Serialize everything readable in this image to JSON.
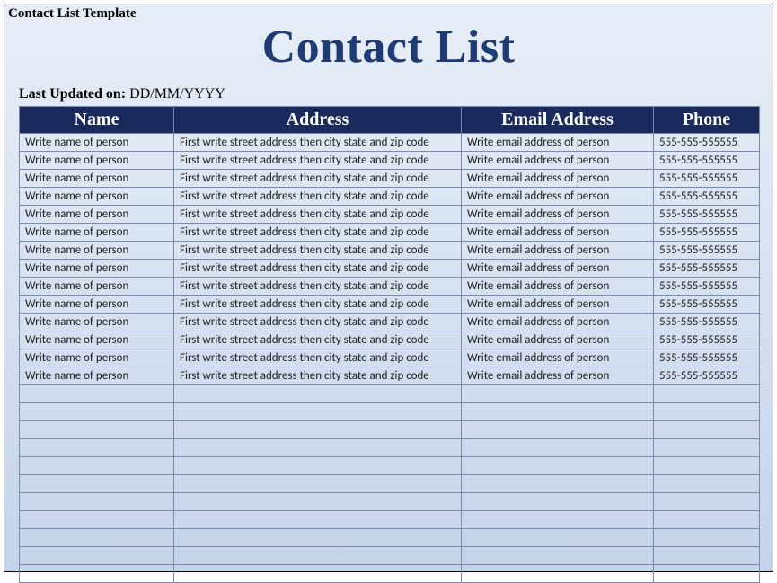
{
  "window_title": "Contact List Template",
  "main_title": "Contact List",
  "last_updated_label": "Last Updated on:",
  "last_updated_value": " DD/MM/YYYY",
  "headers": {
    "name": "Name",
    "address": "Address",
    "email": "Email Address",
    "phone": "Phone"
  },
  "rows": [
    {
      "name": "Write name of person",
      "address": "First write street address then city state and zip code",
      "email": "Write email address of person",
      "phone": "555-555-555555"
    },
    {
      "name": "Write name of person",
      "address": "First write street address then city state and zip code",
      "email": "Write email address of person",
      "phone": "555-555-555555"
    },
    {
      "name": "Write name of person",
      "address": "First write street address then city state and zip code",
      "email": "Write email address of person",
      "phone": "555-555-555555"
    },
    {
      "name": "Write name of person",
      "address": "First write street address then city state and zip code",
      "email": "Write email address of person",
      "phone": "555-555-555555"
    },
    {
      "name": "Write name of person",
      "address": "First write street address then city state and zip code",
      "email": "Write email address of person",
      "phone": "555-555-555555"
    },
    {
      "name": "Write name of person",
      "address": "First write street address then city state and zip code",
      "email": "Write email address of person",
      "phone": "555-555-555555"
    },
    {
      "name": "Write name of person",
      "address": "First write street address then city state and zip code",
      "email": "Write email address of person",
      "phone": "555-555-555555"
    },
    {
      "name": "Write name of person",
      "address": "First write street address then city state and zip code",
      "email": "Write email address of person",
      "phone": "555-555-555555"
    },
    {
      "name": "Write name of person",
      "address": "First write street address then city state and zip code",
      "email": "Write email address of person",
      "phone": "555-555-555555"
    },
    {
      "name": "Write name of person",
      "address": "First write street address then city state and zip code",
      "email": "Write email address of person",
      "phone": "555-555-555555"
    },
    {
      "name": "Write name of person",
      "address": "First write street address then city state and zip code",
      "email": "Write email address of person",
      "phone": "555-555-555555"
    },
    {
      "name": "Write name of person",
      "address": "First write street address then city state and zip code",
      "email": "Write email address of person",
      "phone": "555-555-555555"
    },
    {
      "name": "Write name of person",
      "address": "First write street address then city state and zip code",
      "email": "Write email address of person",
      "phone": "555-555-555555"
    },
    {
      "name": "Write name of person",
      "address": "First write street address then city state and zip code",
      "email": "Write email address of person",
      "phone": "555-555-555555"
    }
  ],
  "empty_row_count": 11
}
